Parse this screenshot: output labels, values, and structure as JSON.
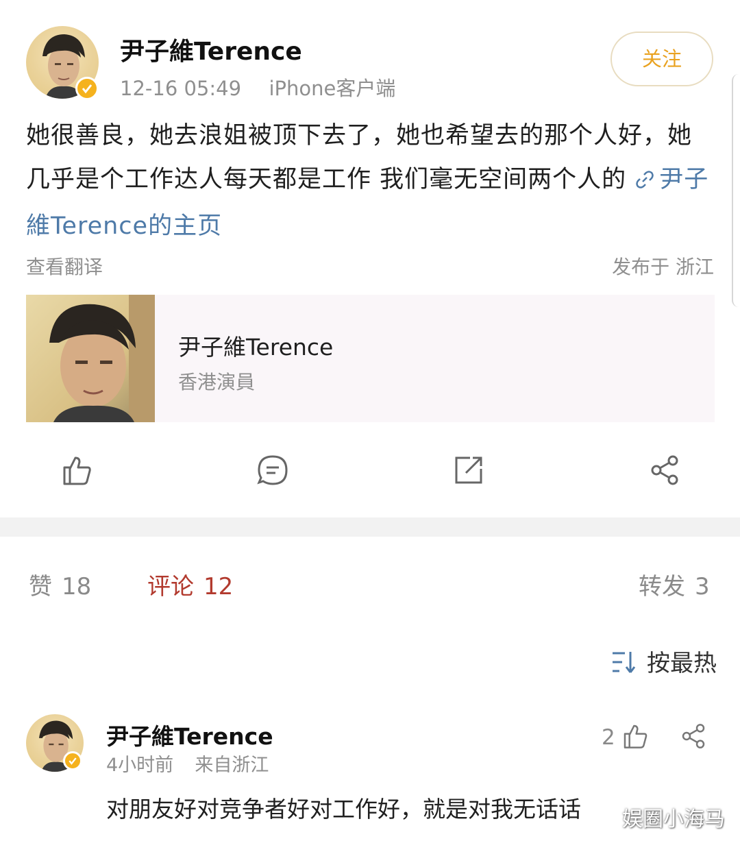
{
  "post": {
    "author": "尹子維Terence",
    "time": "12-16 05:49",
    "source": "iPhone客户端",
    "follow_label": "关注",
    "text": "她很善良，她去浪姐被顶下去了，她也希望去的那个人好，她几乎是个工作达人每天都是工作 我们毫无空间两个人的 ",
    "link_text": "尹子維Terence的主页",
    "translate_label": "查看翻译",
    "published_label": "发布于 浙江"
  },
  "card": {
    "name": "尹子維Terence",
    "desc": "香港演員"
  },
  "actions": [
    "like-icon",
    "comment-icon",
    "repost-icon",
    "share-icon"
  ],
  "stats": {
    "likes_label": "赞",
    "likes": "18",
    "comments_label": "评论",
    "comments": "12",
    "reposts_label": "转发",
    "reposts": "3"
  },
  "sort": {
    "label": "按最热"
  },
  "comment": {
    "author": "尹子維Terence",
    "time": "4小时前",
    "location": "来自浙江",
    "likes": "2",
    "text": "对朋友好对竞争者好对工作好，就是对我无话话"
  },
  "watermark": "娱圈小海马",
  "colors": {
    "accent": "#e9a220",
    "link": "#4e7aa8",
    "active_tab": "#b23a2e",
    "verified": "#f5b21e"
  }
}
